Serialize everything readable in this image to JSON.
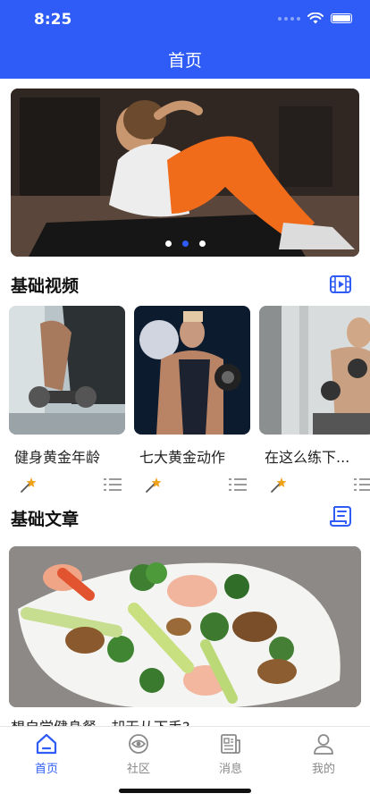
{
  "status": {
    "time": "8:25"
  },
  "header": {
    "title": "首页"
  },
  "banner": {
    "slides": 3,
    "active_index": 1
  },
  "sections": {
    "videos_title": "基础视频",
    "articles_title": "基础文章"
  },
  "videos": [
    {
      "title": "健身黄金年龄"
    },
    {
      "title": "七大黄金动作"
    },
    {
      "title": "在这么练下..."
    }
  ],
  "article": {
    "title": "想自学健身餐，却无从下手?"
  },
  "tabs": [
    {
      "label": "首页",
      "icon": "home-icon",
      "active": true
    },
    {
      "label": "社区",
      "icon": "eye-icon",
      "active": false
    },
    {
      "label": "消息",
      "icon": "news-icon",
      "active": false
    },
    {
      "label": "我的",
      "icon": "user-icon",
      "active": false
    }
  ],
  "colors": {
    "accent": "#2f5cf6"
  }
}
